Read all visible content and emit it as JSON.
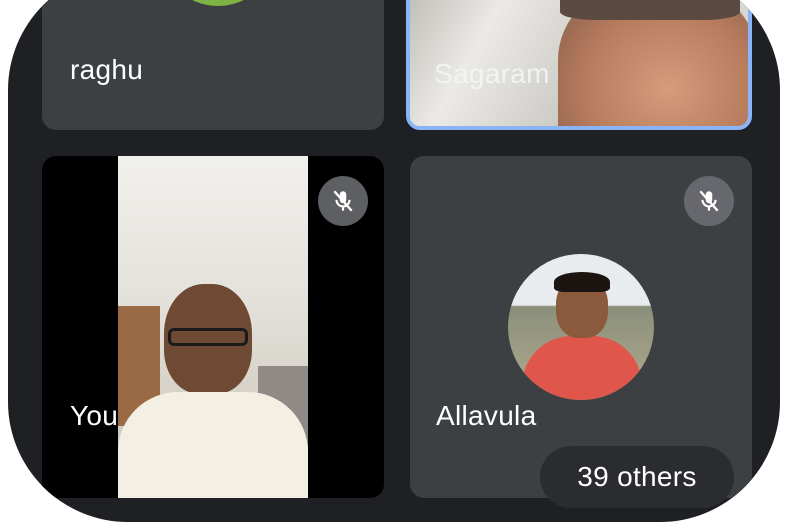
{
  "participants": [
    {
      "name": "raghu",
      "muted": false,
      "avatar_color": "#7cb342"
    },
    {
      "name": "Sagaram",
      "active_speaker": true,
      "highlight_color": "#8ab4f8"
    },
    {
      "name": "You",
      "muted": true
    },
    {
      "name": "Allavula",
      "muted": true
    }
  ],
  "others_label": "39 others",
  "icons": {
    "muted": "mic-off-icon"
  },
  "colors": {
    "background": "#1f2023",
    "tile": "#3c4043",
    "active_border": "#8ab4f8"
  }
}
